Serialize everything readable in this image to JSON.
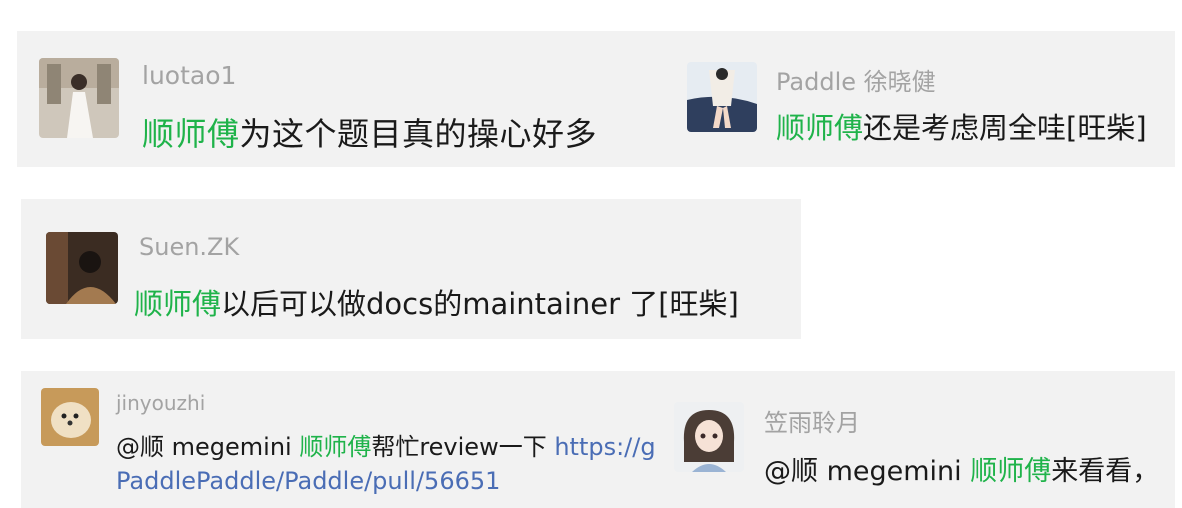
{
  "comments": [
    {
      "author": "luotao1",
      "mention": "",
      "highlight": "顺师傅",
      "text": "为这个题目真的操心好多",
      "avatar_icon": "bride-photo-avatar"
    },
    {
      "author": "Paddle 徐晓健",
      "mention": "",
      "highlight": "顺师傅",
      "text": "还是考虑周全哇[旺柴]",
      "avatar_icon": "anime-girl-avatar"
    },
    {
      "author": "Suen.ZK",
      "mention": "",
      "highlight": "顺师傅",
      "text": "以后可以做docs的maintainer 了[旺柴]",
      "avatar_icon": "person-photo-avatar"
    },
    {
      "author": "jinyouzhi",
      "mention": "@顺 megemini ",
      "highlight": "顺师傅",
      "text": "帮忙review一下 ",
      "link_part1": "https://g",
      "link_part2": "PaddlePaddle/Paddle/pull/56651",
      "avatar_icon": "dog-photo-avatar"
    },
    {
      "author": "笠雨聆月",
      "mention": "@顺 megemini ",
      "highlight": "顺师傅",
      "text": "来看看，",
      "avatar_icon": "illustrated-girl-avatar"
    }
  ],
  "colors": {
    "card_bg": "#f2f2f2",
    "author": "#a3a3a3",
    "highlight": "#1fb34a",
    "link": "#4a6db5",
    "text": "#1a1a1a"
  }
}
